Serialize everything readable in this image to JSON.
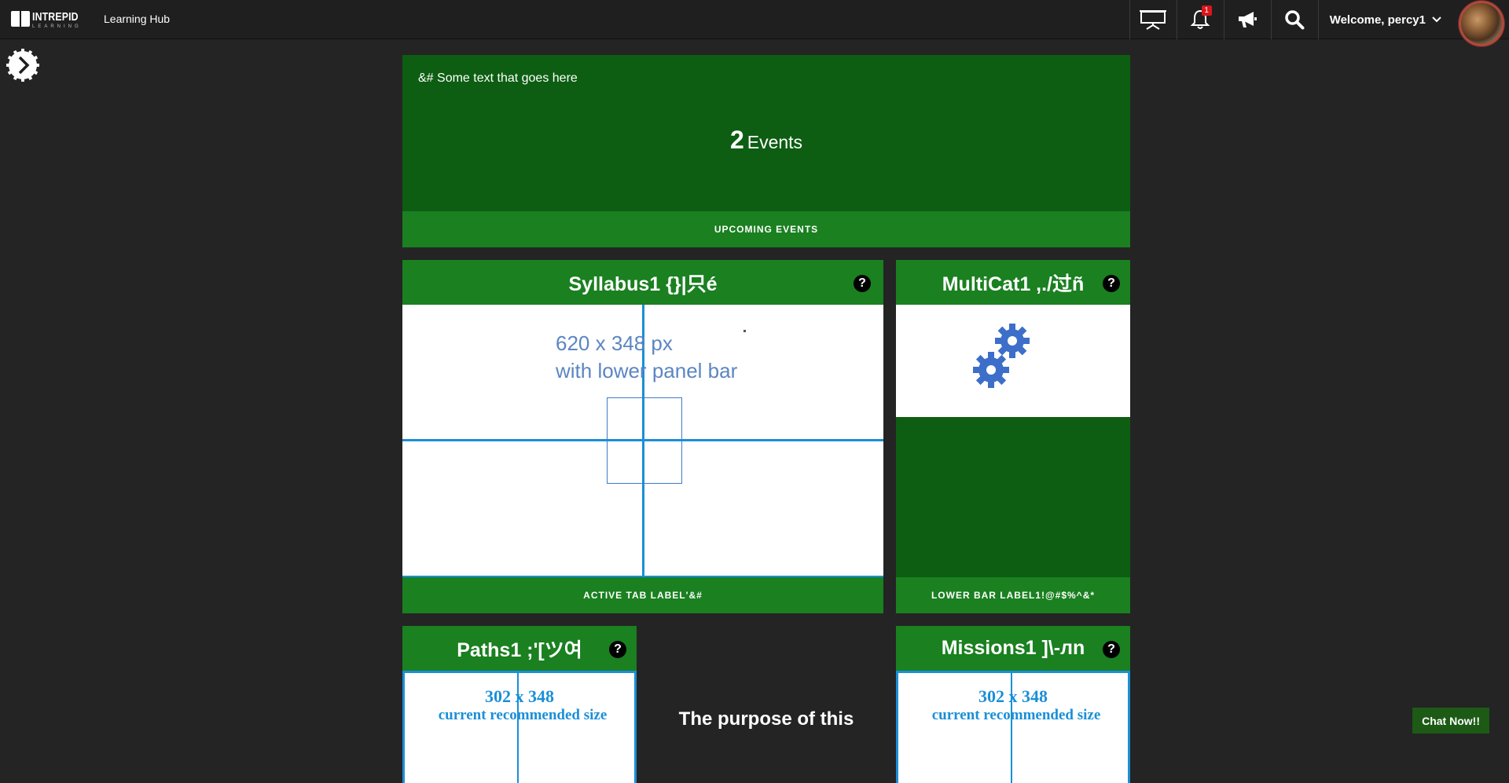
{
  "header": {
    "logo_main": "INTREPID",
    "logo_sub": "LEARNING",
    "app_title": "Learning Hub",
    "notification_count": "1",
    "welcome_text": "Welcome, percy1",
    "icons": [
      "presentation-icon",
      "bell-icon",
      "megaphone-icon",
      "search-icon",
      "chevron-down-icon"
    ]
  },
  "events": {
    "caption": "&# Some text that goes here",
    "count": "2",
    "count_label": "Events",
    "lower_bar_label": "UPCOMING EVENTS"
  },
  "syllabus": {
    "title": "Syllabus1 {}|只é",
    "image_text_line1": "620 x 348 px",
    "image_text_line2": "with lower panel bar",
    "lower_bar_label": "ACTIVE TAB LABEL'&#"
  },
  "multicat": {
    "title": "MultiCat1 ,./过ñ",
    "lower_bar_label": "LOWER BAR LABEL1!@#$%^&*"
  },
  "paths": {
    "title": "Paths1 ;'[ツ여",
    "image_text_line1": "302 x 348",
    "image_text_line2": "current recommended size"
  },
  "missions": {
    "title": "Missions1 ]\\-лn",
    "image_text_line1": "302 x 348",
    "image_text_line2": "current recommended size"
  },
  "purpose_text": "The purpose of this",
  "chat_button": "Chat Now!!",
  "colors": {
    "card_dark": "#0d5e12",
    "card_bar": "#1a8020",
    "placeholder_blue": "#1a8fd8",
    "gear_blue": "#3d6ec9"
  }
}
